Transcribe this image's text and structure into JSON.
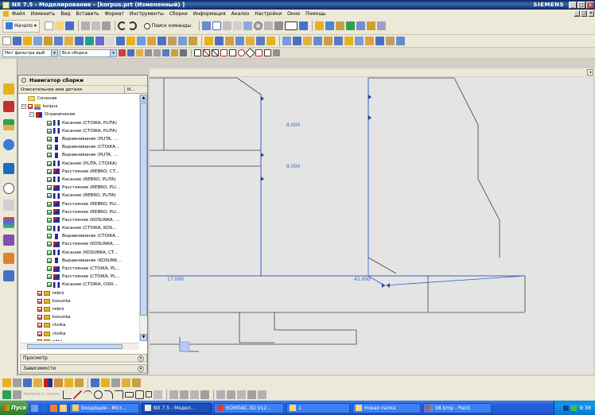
{
  "window": {
    "title": "NX 7.5 - Моделирование - [korpus.prt (Измененный) ]",
    "brand": "SIEMENS"
  },
  "menu": {
    "items": [
      "Файл",
      "Изменить",
      "Вид",
      "Вставить",
      "Формат",
      "Инструменты",
      "Сборки",
      "Информация",
      "Анализ",
      "Настройки",
      "Окно",
      "Помощь"
    ]
  },
  "toolbar": {
    "start_label": "Начало",
    "search_label": "Поиск команды",
    "filter_combo": "Нет фильтра выб",
    "assembly_combo": "Вся сборка"
  },
  "navigator": {
    "title": "Навигатор сборки",
    "col_name": "Описательное имя детали",
    "col_info": "И...",
    "sections_label": "Сечения",
    "root_label": "korpus",
    "constraints_label": "Ограничения",
    "constraints": [
      "Касание (CTOIKA, PLITA)",
      "Касание (CTOIKA, PLITA)",
      "Выравнивание (PLITA, ...",
      "Выравнивание (CTOIKA...",
      "Выравнивание (PLITA, ...",
      "Касание (PLITA, CTOIKA)",
      "Расстояние (REBRO, CT...",
      "Касание (REBRO, PLITA)",
      "Расстояние (REBRO, PLI...",
      "Касание (REBRO, PLITA)",
      "Расстояние (REBRO, PLI...",
      "Расстояние (REBRO, PLI...",
      "Расстояние (KOSUNKA, ...",
      "Касание (CTOIKA, KOS...",
      "Выравнивание (CTOIKA...",
      "Расстояние (KOSUNKA, ...",
      "Касание (KOSUNKA, CT...",
      "Выравнивание (KOSUNK...",
      "Расстояние (CTOIKA, PL...",
      "Расстояние (CTOIKA, PL...",
      "Касание (CTOIKA, OSN..."
    ],
    "constraint_types": [
      "touch",
      "touch",
      "align",
      "align",
      "align",
      "touch",
      "dist",
      "touch",
      "dist",
      "touch",
      "dist",
      "dist",
      "dist",
      "touch",
      "align",
      "dist",
      "touch",
      "align",
      "dist",
      "dist",
      "touch"
    ],
    "parts": [
      "rebro",
      "kosunka",
      "rebro",
      "kosunka",
      "ctoika",
      "ctoika",
      "plita"
    ],
    "panels": [
      "Просмотр",
      "Зависимости"
    ]
  },
  "viewport": {
    "dimensions": [
      "9.000",
      "9.000",
      "17.000",
      "42.000"
    ]
  },
  "bottom_toolbar": {
    "disabled_label": "Заменить эскиз"
  },
  "taskbar": {
    "start_label": "Пуск",
    "tasks": [
      "Входящие - Micr...",
      "NX 7.5 - Модел...",
      "КОМПАС-3D V12...",
      "1",
      "Новая папка",
      "98.bmp - Paint"
    ],
    "active_index": 1,
    "clock": "9:38"
  }
}
